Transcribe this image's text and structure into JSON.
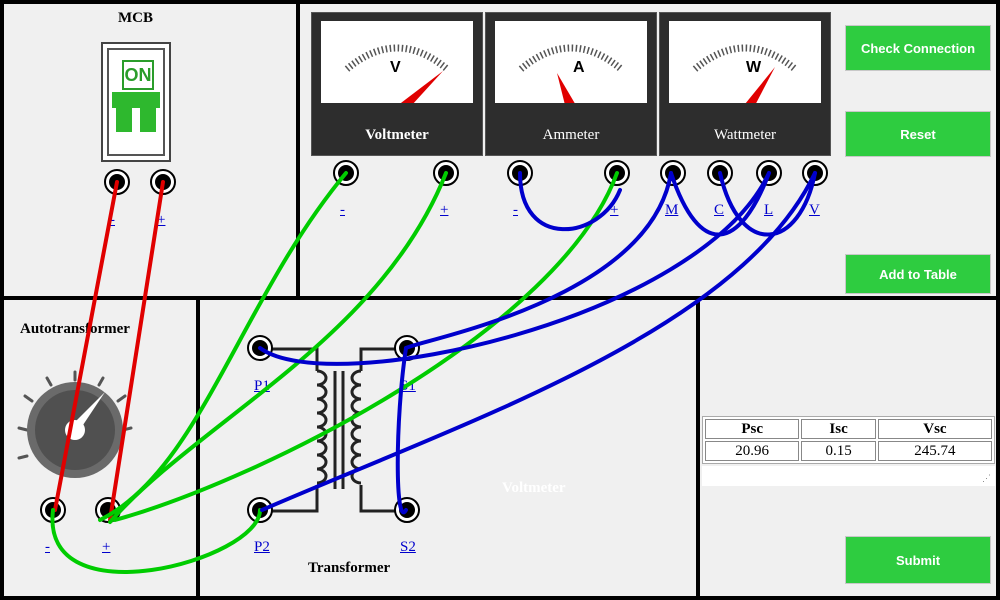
{
  "mcb": {
    "title": "MCB",
    "switch_label": "ON",
    "terminal_minus": "-",
    "terminal_plus": "+"
  },
  "meters": {
    "voltmeter": {
      "symbol": "V",
      "label": "Voltmeter",
      "t1": "-",
      "t2": "+"
    },
    "ammeter": {
      "symbol": "A",
      "label": "Ammeter",
      "t1": "-",
      "t2": "+"
    },
    "wattmeter": {
      "symbol": "W",
      "label": "Wattmeter",
      "t1": "M",
      "t2": "C",
      "t3": "L",
      "t4": "V"
    }
  },
  "buttons": {
    "check": "Check Connection",
    "reset": "Reset",
    "add": "Add to Table",
    "submit": "Submit"
  },
  "autotransformer": {
    "title": "Autotransformer",
    "t1": "-",
    "t2": "+"
  },
  "transformer": {
    "title": "Transformer",
    "p1": "P1",
    "p2": "P2",
    "s1": "S1",
    "s2": "S2",
    "watermark": "Voltmeter"
  },
  "table": {
    "headers": [
      "Psc",
      "Isc",
      "Vsc"
    ],
    "row": [
      "20.96",
      "0.15",
      "245.74"
    ]
  },
  "colors": {
    "button": "#2ecc40",
    "wire_red": "#e00000",
    "wire_green": "#00cc00",
    "wire_blue": "#0000cc"
  }
}
